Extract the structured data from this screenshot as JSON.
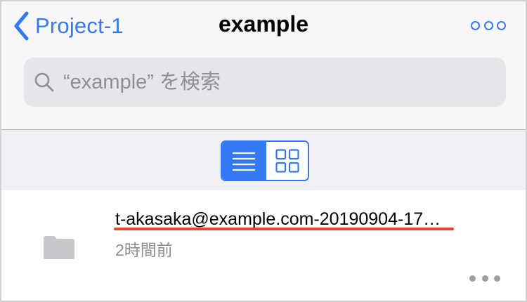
{
  "nav": {
    "back_label": "Project-1",
    "title": "example",
    "back_icon": "chevron-left-icon",
    "more_icon": "more-circles-icon"
  },
  "search": {
    "placeholder": "“example” を検索",
    "value": "",
    "icon": "search-icon"
  },
  "view_toggle": {
    "options": [
      {
        "name": "list-view",
        "icon": "list-icon",
        "selected": true
      },
      {
        "name": "grid-view",
        "icon": "grid-icon",
        "selected": false
      }
    ]
  },
  "files": [
    {
      "name": "t-akasaka@example.com-20190904-17…",
      "modified": "2時間前",
      "icon": "folder-icon",
      "more_icon": "ellipsis-icon"
    }
  ],
  "colors": {
    "accent": "#3478f6",
    "annotation_underline": "#e8472e",
    "secondary_text": "#8e8e93",
    "header_bg": "#f7f7f8",
    "search_bg": "#e5e5ea",
    "folder": "#c7c7cc"
  }
}
